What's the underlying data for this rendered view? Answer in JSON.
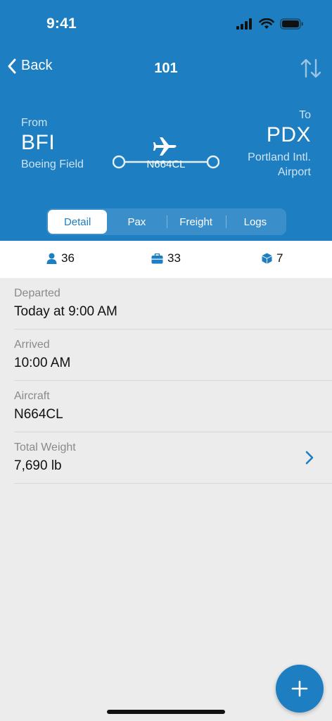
{
  "status_bar": {
    "time": "9:41"
  },
  "nav": {
    "back_label": "Back",
    "title": "101"
  },
  "route": {
    "from_label": "From",
    "from_code": "BFI",
    "from_name": "Boeing Field",
    "to_label": "To",
    "to_code": "PDX",
    "to_name": "Portland Intl. Airport",
    "tail_number": "N664CL"
  },
  "tabs": [
    {
      "label": "Detail",
      "active": true
    },
    {
      "label": "Pax",
      "active": false
    },
    {
      "label": "Freight",
      "active": false
    },
    {
      "label": "Logs",
      "active": false
    }
  ],
  "counts": {
    "passengers": "36",
    "bags": "33",
    "packages": "7"
  },
  "details": [
    {
      "label": "Departed",
      "value": "Today at 9:00 AM"
    },
    {
      "label": "Arrived",
      "value": "10:00 AM"
    },
    {
      "label": "Aircraft",
      "value": "N664CL"
    },
    {
      "label": "Total Weight",
      "value": "7,690 lb"
    }
  ],
  "icons": {
    "back": "chevron-left-icon",
    "swap": "swap-arrows-icon",
    "plane": "airplane-icon",
    "person": "person-icon",
    "bag": "briefcase-icon",
    "package": "cube-icon",
    "chevron": "chevron-right-icon",
    "add": "plus-icon"
  },
  "colors": {
    "brand": "#1d7ec1",
    "background": "#ececec"
  }
}
